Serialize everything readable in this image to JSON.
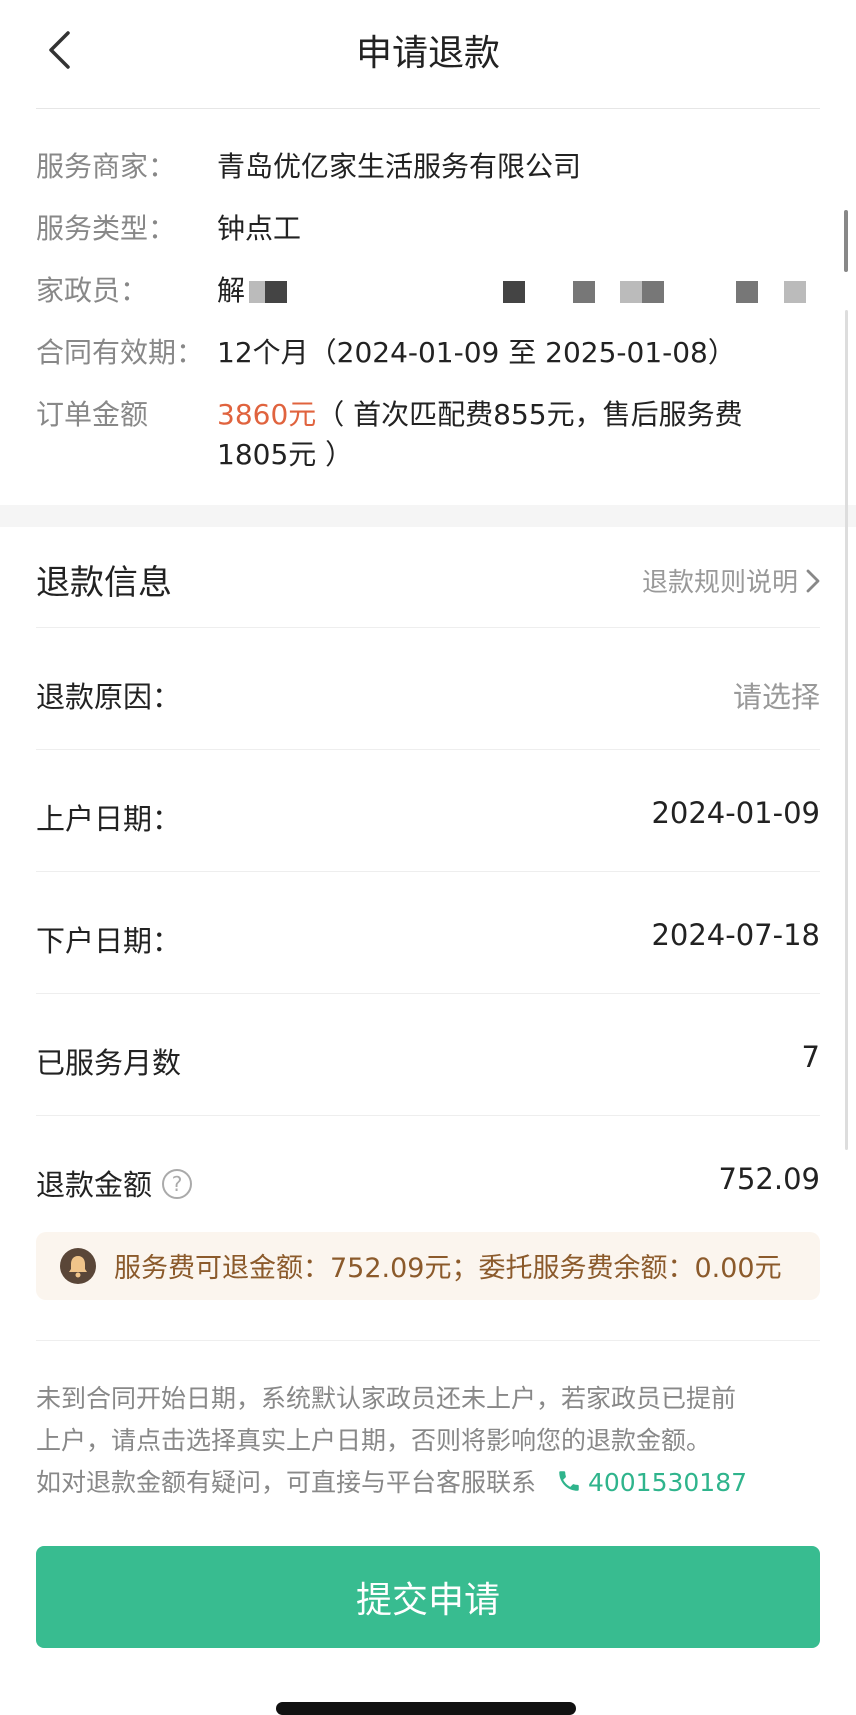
{
  "header": {
    "title": "申请退款",
    "back_icon": "chevron-left-icon"
  },
  "order_info": {
    "merchant": {
      "label": "服务商家：",
      "value": "青岛优亿家生活服务有限公司"
    },
    "service_type": {
      "label": "服务类型：",
      "value": "钟点工"
    },
    "housekeeper": {
      "label": "家政员：",
      "value": "解"
    },
    "contract": {
      "label": "合同有效期：",
      "value": "12个月（2024-01-09 至 2025-01-08）"
    },
    "amount": {
      "label": "订单金额",
      "value": "3860元",
      "detail_line1": "（ 首次匹配费855元，售后服务费",
      "detail_line2": "1805元 ）"
    }
  },
  "refund": {
    "section_title": "退款信息",
    "rules_link": "退款规则说明",
    "reason": {
      "label": "退款原因：",
      "placeholder": "请选择"
    },
    "start_date": {
      "label": "上户日期：",
      "value": "2024-01-09"
    },
    "end_date": {
      "label": "下户日期：",
      "value": "2024-07-18"
    },
    "months": {
      "label": "已服务月数",
      "value": "7"
    },
    "refund_amount": {
      "label": "退款金额",
      "help": "?",
      "value": "752.09"
    },
    "notice": "服务费可退金额：752.09元；委托服务费余额：0.00元",
    "note_line1": "未到合同开始日期，系统默认家政员还未上户，若家政员已提前",
    "note_line2": "上户，请点击选择真实上户日期，否则将影响您的退款金额。",
    "note_line3": "如对退款金额有疑问，可直接与平台客服联系",
    "phone": "4001530187"
  },
  "submit_label": "提交申请",
  "colors": {
    "accent": "#38bc90",
    "amount_red": "#e0633e",
    "notice_bg": "#fbf5ee",
    "notice_text": "#8b5a2b",
    "phone_green": "#2fb48c"
  }
}
